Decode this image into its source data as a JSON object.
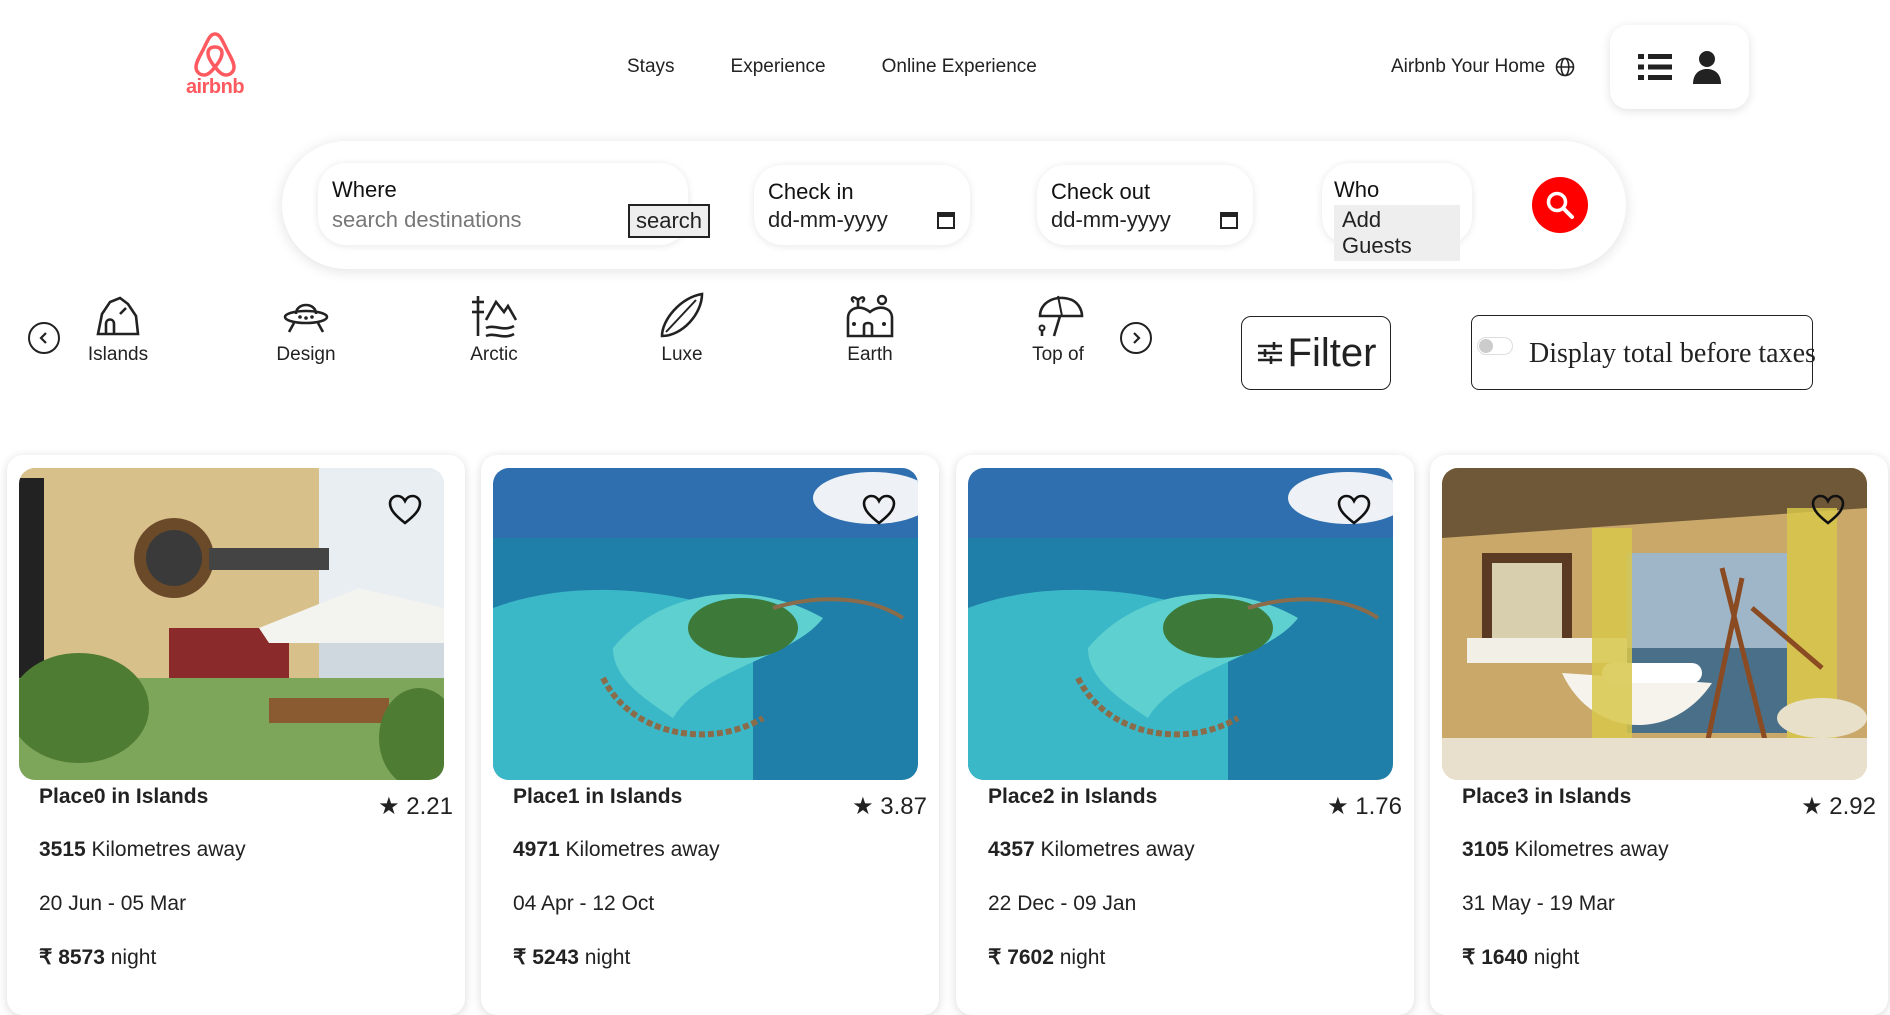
{
  "logo": {
    "text": "airbnb"
  },
  "nav": {
    "stays": "Stays",
    "experience": "Experience",
    "online": "Online Experience"
  },
  "host": {
    "label": "Airbnb Your Home"
  },
  "search": {
    "where_label": "Where",
    "where_placeholder": "search destinations",
    "search_button": "search",
    "checkin_label": "Check in",
    "checkin_value": "dd-mm-yyyy",
    "checkout_label": "Check out",
    "checkout_value": "dd-mm-yyyy",
    "who_label": "Who",
    "who_value": "Add Guests"
  },
  "categories": [
    {
      "label": "Islands",
      "icon": "islands-icon"
    },
    {
      "label": "Design",
      "icon": "ufo-icon"
    },
    {
      "label": "Arctic",
      "icon": "arctic-icon"
    },
    {
      "label": "Luxe",
      "icon": "surfboard-icon"
    },
    {
      "label": "Earth",
      "icon": "earth-house-icon"
    },
    {
      "label": "Top of",
      "icon": "umbrella-icon"
    }
  ],
  "filter": {
    "label": "Filter"
  },
  "taxes": {
    "label": "Display total before taxes",
    "enabled": false
  },
  "listings": [
    {
      "title": "Place0 in Islands",
      "rating": "★ 2.21",
      "distance": "3515",
      "distance_suffix": " Kilometres away",
      "dates": "20 Jun - 05 Mar",
      "price": "₹ 8573",
      "price_suffix": " night"
    },
    {
      "title": "Place1 in Islands",
      "rating": "★ 3.87",
      "distance": "4971",
      "distance_suffix": " Kilometres away",
      "dates": "04 Apr - 12 Oct",
      "price": "₹ 5243",
      "price_suffix": " night"
    },
    {
      "title": "Place2 in Islands",
      "rating": "★ 1.76",
      "distance": "4357",
      "distance_suffix": " Kilometres away",
      "dates": "22 Dec - 09 Jan",
      "price": "₹ 7602",
      "price_suffix": " night"
    },
    {
      "title": "Place3 in Islands",
      "rating": "★ 2.92",
      "distance": "3105",
      "distance_suffix": " Kilometres away",
      "dates": "31 May - 19 Mar",
      "price": "₹ 1640",
      "price_suffix": " night"
    }
  ],
  "colors": {
    "brand": "#ff5a60",
    "search_button": "#ff0000"
  }
}
